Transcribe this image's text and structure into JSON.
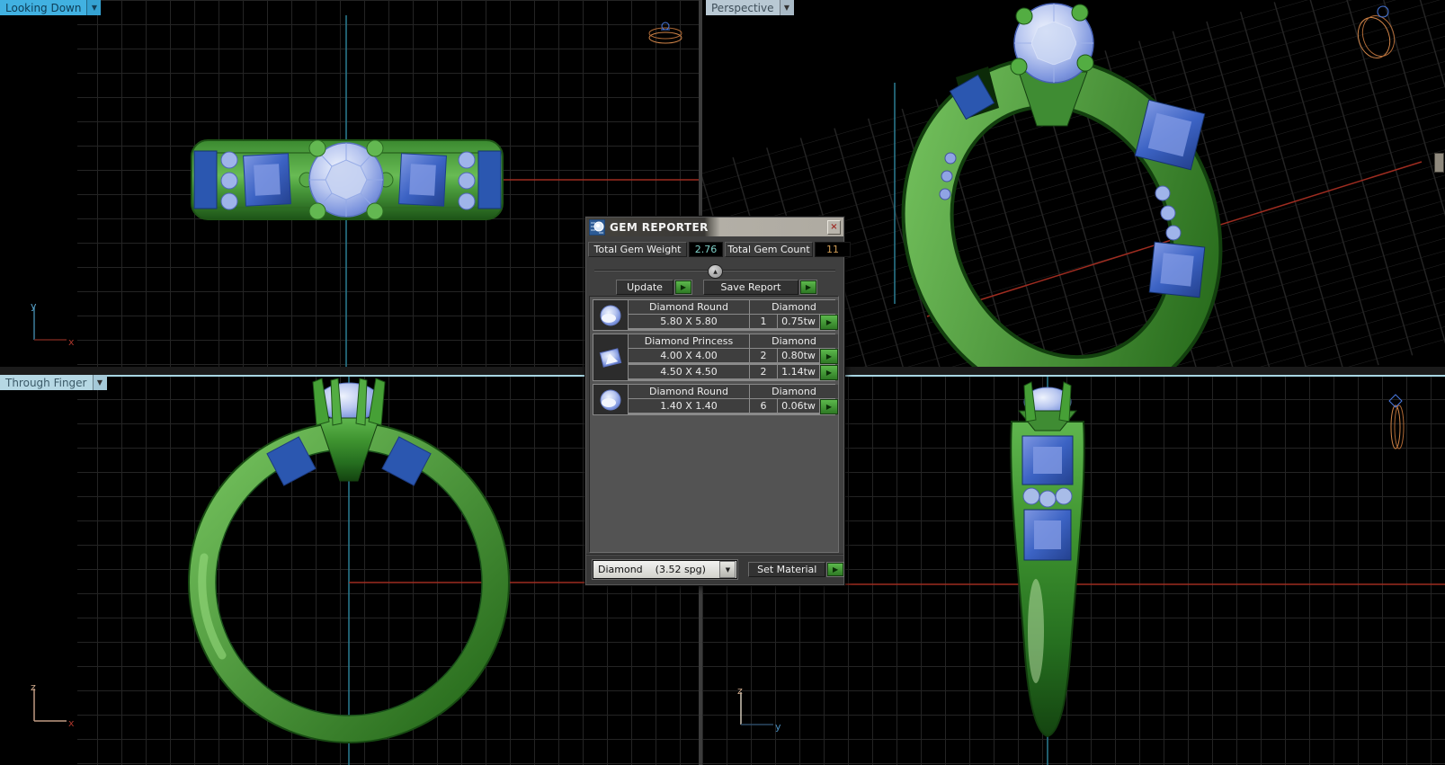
{
  "viewports": {
    "looking_down": {
      "label": "Looking Down",
      "axis_vertical": "y",
      "axis_horizontal": "x"
    },
    "perspective": {
      "label": "Perspective"
    },
    "through_finger": {
      "label": "Through Finger",
      "axis_vertical": "z",
      "axis_horizontal": "x"
    },
    "side": {
      "axis_vertical": "z",
      "axis_horizontal": "y"
    }
  },
  "icons": {
    "viewport_dropdown": "▼",
    "collapse": "▲",
    "run": "▶",
    "close": "×",
    "material_dropdown": "▼"
  },
  "dialog": {
    "title": "GEM REPORTER",
    "totals": {
      "weight_label": "Total Gem Weight",
      "weight_value": "2.76",
      "count_label": "Total Gem Count",
      "count_value": "11"
    },
    "buttons": {
      "update": "Update",
      "save_report": "Save Report",
      "set_material": "Set Material"
    },
    "groups": [
      {
        "icon": "round-gem",
        "name": "Diamond Round",
        "material": "Diamond",
        "rows": [
          {
            "size": "5.80 X 5.80",
            "count": "1",
            "weight": "0.75tw"
          }
        ]
      },
      {
        "icon": "princess-gem",
        "name": "Diamond Princess",
        "material": "Diamond",
        "rows": [
          {
            "size": "4.00 X 4.00",
            "count": "2",
            "weight": "0.80tw"
          },
          {
            "size": "4.50 X 4.50",
            "count": "2",
            "weight": "1.14tw"
          }
        ]
      },
      {
        "icon": "round-gem",
        "name": "Diamond Round",
        "material": "Diamond",
        "rows": [
          {
            "size": "1.40 X 1.40",
            "count": "6",
            "weight": "0.06tw"
          }
        ]
      }
    ],
    "material_dropdown": {
      "value": "Diamond",
      "detail": "(3.52 spg)"
    }
  },
  "colors": {
    "ring_green": "#4da03d",
    "gem_blue": "#5f7fd0",
    "axis_x_red": "#9e2c20",
    "axis_y_cyan": "#2a7d92",
    "active_tab_blue": "#41b1e1",
    "inactive_tab": "#b9c9d4",
    "run_button_green": "#3f9c32",
    "weight_value_teal": "#7fd0c8",
    "count_value_orange": "#cf9c55"
  }
}
